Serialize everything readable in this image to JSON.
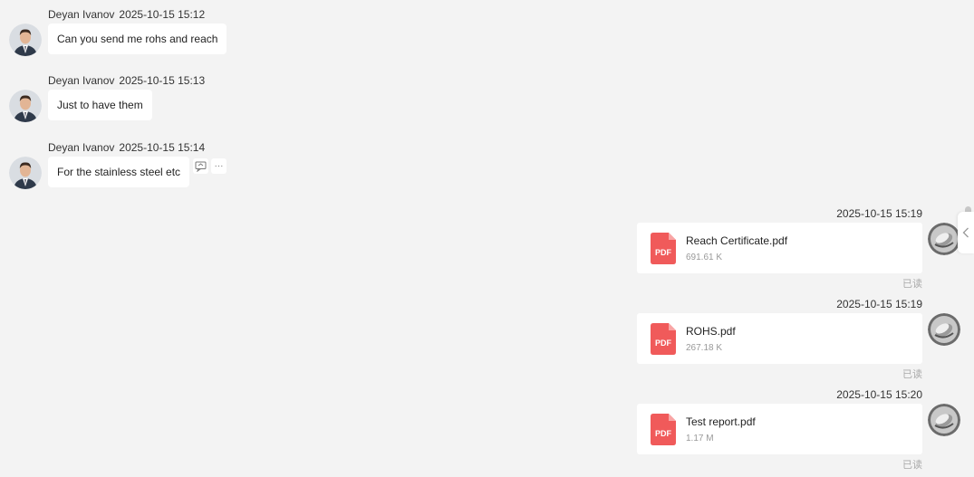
{
  "incoming": [
    {
      "sender": "Deyan Ivanov",
      "time": "2025-10-15 15:12",
      "text": "Can you send me rohs and reach"
    },
    {
      "sender": "Deyan Ivanov",
      "time": "2025-10-15 15:13",
      "text": "Just to have them"
    },
    {
      "sender": "Deyan Ivanov",
      "time": "2025-10-15 15:14",
      "text": "For the stainless steel etc"
    }
  ],
  "outgoing": [
    {
      "time": "2025-10-15 15:19",
      "file_name": "Reach Certificate.pdf",
      "file_size": "691.61 K",
      "status": "已读",
      "file_type": "PDF"
    },
    {
      "time": "2025-10-15 15:19",
      "file_name": "ROHS.pdf",
      "file_size": "267.18 K",
      "status": "已读",
      "file_type": "PDF"
    },
    {
      "time": "2025-10-15 15:20",
      "file_name": "Test report.pdf",
      "file_size": "1.17 M",
      "status": "已读",
      "file_type": "PDF"
    }
  ],
  "tools": {
    "reply_icon": "quote-reply-icon",
    "more_icon": "more-icon",
    "more_glyph": "···"
  },
  "colors": {
    "background": "#f3f3f3",
    "pdf": "#f05a5a",
    "bubble": "#ffffff"
  }
}
